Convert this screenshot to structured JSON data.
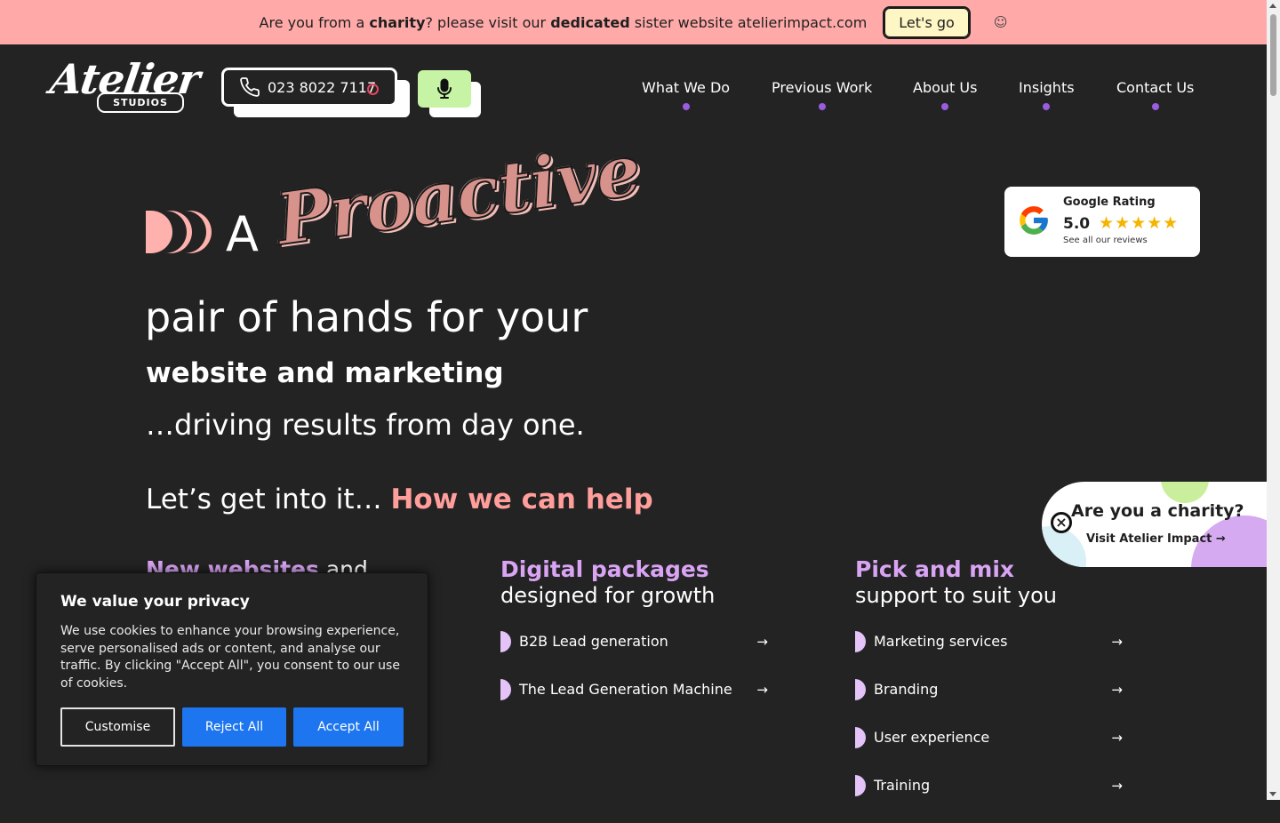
{
  "banner": {
    "text_pre": "Are you from a ",
    "text_bold1": "charity",
    "text_mid": "? please visit our ",
    "text_bold2": "dedicated",
    "text_post": " sister website atelierimpact.com",
    "button_label": "Let's go",
    "close_glyph": "☺"
  },
  "logo": {
    "word": "Atelier",
    "sub": "STUDIOS"
  },
  "phone": {
    "number": "023 8022 7117"
  },
  "nav": {
    "items": [
      "What We Do",
      "Previous Work",
      "About Us",
      "Insights",
      "Contact Us"
    ]
  },
  "hero": {
    "word_a": "A",
    "word_script": "Proactive",
    "line1": "pair of hands for your",
    "line2": "website and marketing",
    "line3": "…driving results from day one.",
    "help_pre": "Let’s get into it… ",
    "help_accent": "How we can help"
  },
  "google": {
    "title": "Google Rating",
    "score": "5.0",
    "stars": "★★★★★",
    "sub": "See all our reviews"
  },
  "charity_card": {
    "title": "Are you a charity?",
    "link": "Visit Atelier Impact",
    "arrow": "→",
    "close": "×"
  },
  "columns": [
    {
      "heading_accent": "New websites",
      "heading_rest": " and"
    },
    {
      "heading_accent": "Digital packages",
      "heading_rest": "designed for growth",
      "items": [
        "B2B Lead generation",
        "The Lead Generation Machine"
      ]
    },
    {
      "heading_accent": "Pick and mix",
      "heading_rest": "support to suit you",
      "items": [
        "Marketing services",
        "Branding",
        "User experience",
        "Training"
      ]
    }
  ],
  "arrow_glyph": "→",
  "cookie": {
    "title": "We value your privacy",
    "body": "We use cookies to enhance your browsing experience, serve personalised ads or content, and analyse our traffic. By clicking \"Accept All\", you consent to our use of cookies.",
    "customise": "Customise",
    "reject": "Reject All",
    "accept": "Accept All"
  },
  "colors": {
    "banner_bg": "#ffaaa8",
    "page_bg": "#232323",
    "accent_pink": "#ff9e9b",
    "accent_purple": "#d9a4f4",
    "nav_dot": "#9b5ce0",
    "mic_bg": "#c6f3a4",
    "cookie_button": "#1d76f0"
  }
}
